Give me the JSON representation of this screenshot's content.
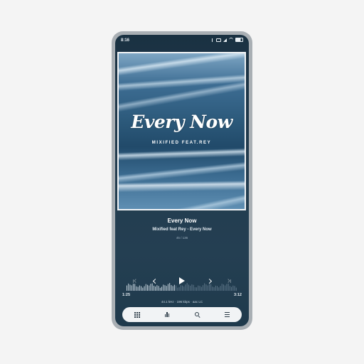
{
  "status_bar": {
    "time": "8:16",
    "icons": [
      "bluetooth-icon",
      "nfc-icon",
      "signal-icon",
      "wifi-icon",
      "battery-icon"
    ]
  },
  "album_art": {
    "title": "Every Now",
    "artist": "MIXIFIED FEAT.REY"
  },
  "track": {
    "title": "Every Now",
    "subtitle": "Mixified feat Rey - Every Now",
    "position": "45 / 136"
  },
  "controls": {
    "icons": [
      "skip-previous-icon",
      "previous-icon",
      "play-icon",
      "next-icon",
      "skip-next-icon"
    ]
  },
  "progress": {
    "elapsed": "1:25",
    "duration": "3:12",
    "fraction": 0.44
  },
  "audio_format": "44.1 kHz · 196 kbps · aac LC",
  "nav": {
    "icons": [
      "grid-icon",
      "equalizer-icon",
      "search-icon",
      "menu-icon"
    ]
  },
  "colors": {
    "background": "#223c4f",
    "accent": "#ffffff",
    "nav_bg": "#f1f3f5"
  }
}
